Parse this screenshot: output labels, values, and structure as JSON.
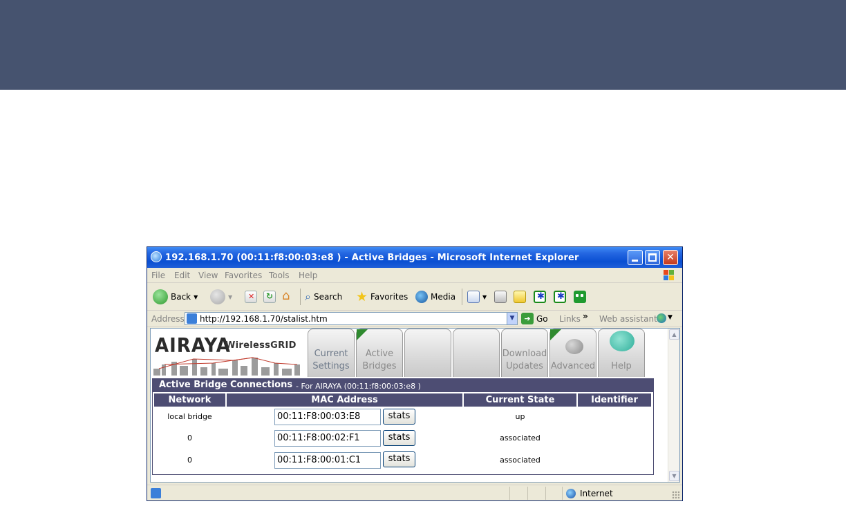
{
  "window": {
    "title": "192.168.1.70 (00:11:f8:00:03:e8 ) - Active Bridges - Microsoft Internet Explorer"
  },
  "menu": [
    "File",
    "Edit",
    "View",
    "Favorites",
    "Tools",
    "Help"
  ],
  "toolbar": {
    "back_label": "Back",
    "search_label": "Search",
    "favorites_label": "Favorites",
    "media_label": "Media"
  },
  "address": {
    "label": "Address",
    "url": "http://192.168.1.70/stalist.htm",
    "go_label": "Go",
    "links_label": "Links",
    "web_assistant_label": "Web assistant"
  },
  "brand": {
    "logo": "AIRAYA",
    "product": "WirelessGRID"
  },
  "tabs": [
    {
      "line1": "Current",
      "line2": "Settings"
    },
    {
      "line1": "Active",
      "line2": "Bridges"
    },
    {
      "line1": "",
      "line2": ""
    },
    {
      "line1": "",
      "line2": ""
    },
    {
      "line1": "Download",
      "line2": "Updates"
    },
    {
      "line1": "",
      "line2": "Advanced"
    },
    {
      "line1": "",
      "line2": "Help"
    }
  ],
  "section": {
    "title": "Active Bridge Connections",
    "subtitle": "- For AIRAYA (00:11:f8:00:03:e8 )"
  },
  "table": {
    "headers": [
      "Network",
      "MAC Address",
      "Current State",
      "Identifier"
    ],
    "stats_label": "stats",
    "rows": [
      {
        "network": "local bridge",
        "mac": "00:11:F8:00:03:E8",
        "state": "up",
        "identifier": ""
      },
      {
        "network": "0",
        "mac": "00:11:F8:00:02:F1",
        "state": "associated",
        "identifier": ""
      },
      {
        "network": "0",
        "mac": "00:11:F8:00:01:C1",
        "state": "associated",
        "identifier": ""
      }
    ]
  },
  "status": {
    "zone": "Internet"
  },
  "colors": {
    "slide_band": "#46536f",
    "section_bar": "#4d4d73",
    "xp_titlebar": "#0a4fd2"
  }
}
